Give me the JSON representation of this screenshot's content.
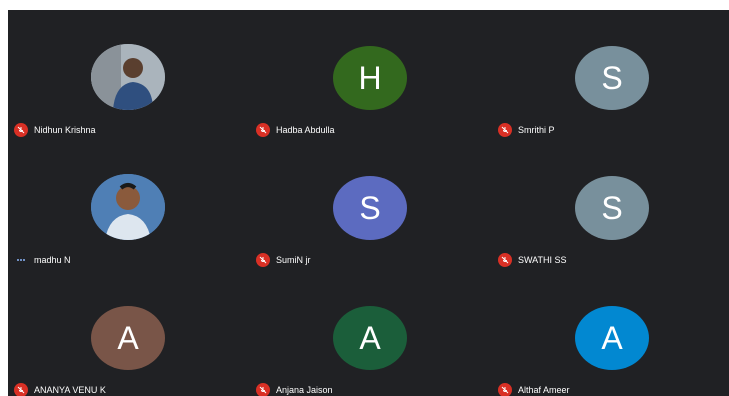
{
  "participants": [
    {
      "name": "Nidhun Krishna",
      "initial": "",
      "color": "#6c7a89",
      "photo": true,
      "mic": "muted"
    },
    {
      "name": "Hadba Abdulla",
      "initial": "H",
      "color": "#33691e",
      "photo": false,
      "mic": "muted"
    },
    {
      "name": "Smrithi P",
      "initial": "S",
      "color": "#78909c",
      "photo": false,
      "mic": "muted"
    },
    {
      "name": "madhu N",
      "initial": "",
      "color": "#4f7fb5",
      "photo": true,
      "mic": "speaking"
    },
    {
      "name": "SumiN jr",
      "initial": "S",
      "color": "#5c6bc0",
      "photo": false,
      "mic": "muted"
    },
    {
      "name": "SWATHI SS",
      "initial": "S",
      "color": "#78909c",
      "photo": false,
      "mic": "muted"
    },
    {
      "name": "ANANYA VENU K",
      "initial": "A",
      "color": "#795548",
      "photo": false,
      "mic": "muted"
    },
    {
      "name": "Anjana Jaison",
      "initial": "A",
      "color": "#1b5e3a",
      "photo": false,
      "mic": "muted"
    },
    {
      "name": "Althaf Ameer",
      "initial": "A",
      "color": "#0288d1",
      "photo": false,
      "mic": "muted"
    }
  ]
}
